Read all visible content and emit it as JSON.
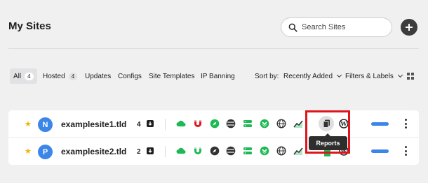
{
  "header": {
    "title": "My Sites",
    "search_placeholder": "Search Sites"
  },
  "filters": {
    "tabs": [
      {
        "label": "All",
        "count": "4",
        "active": true
      },
      {
        "label": "Hosted",
        "count": "4"
      },
      {
        "label": "Updates"
      },
      {
        "label": "Configs"
      },
      {
        "label": "Site Templates"
      },
      {
        "label": "IP Banning"
      }
    ],
    "sort_label": "Sort by:",
    "sort_value": "Recently Added",
    "filters_labels": "Filters & Labels"
  },
  "sites": [
    {
      "initial": "N",
      "name": "examplesite1.tld",
      "count": "4",
      "avatar_color": "#3b86e8"
    },
    {
      "initial": "P",
      "name": "examplesite2.tld",
      "count": "2",
      "avatar_color": "#3b86e8"
    }
  ],
  "tooltip": "Reports",
  "colors": {
    "accent": "#3b86e8",
    "green": "#1db954",
    "red": "#e0151c",
    "star": "#f0b400"
  },
  "row_icons": [
    "cloud-icon",
    "magnet-icon",
    "compass-icon",
    "database-icon",
    "server-icon",
    "cdn-icon",
    "globe-icon",
    "analytics-icon"
  ]
}
